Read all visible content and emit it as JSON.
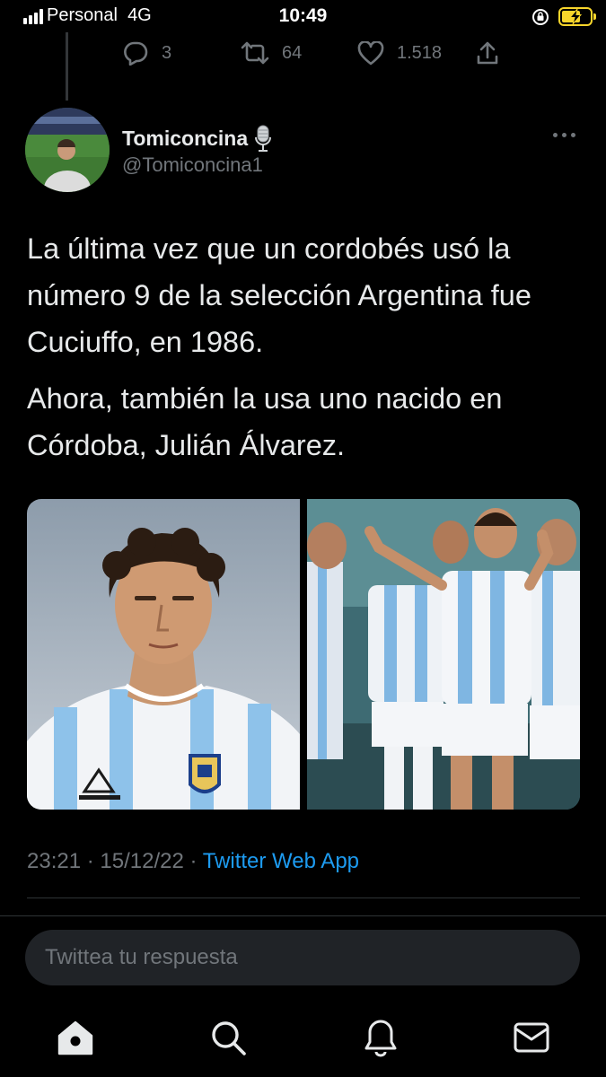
{
  "status_bar": {
    "carrier": "Personal",
    "network": "4G",
    "time": "10:49",
    "battery_color": "#f7d52b"
  },
  "previous_tweet_actions": {
    "replies": "3",
    "retweets": "64",
    "likes": "1.518"
  },
  "tweet": {
    "author_name": "Tomiconcina",
    "author_handle": "@Tomiconcina1",
    "name_badge_icon": "microphone-icon",
    "paragraph_1": "La última vez que un cordobés usó la número 9 de la selección Argentina fue Cuciuffo, en 1986.",
    "paragraph_2": "Ahora, también la usa uno nacido en Córdoba, Julián Álvarez.",
    "timestamp": "23:21 · 15/12/22 · ",
    "source": "Twitter Web App"
  },
  "reply": {
    "placeholder": "Twittea tu respuesta"
  },
  "tab_bar": {
    "icons": [
      "home-icon",
      "search-icon",
      "notifications-icon",
      "messages-icon"
    ]
  },
  "colors": {
    "background": "#000000",
    "text": "#e7e9ea",
    "muted": "#71767b",
    "accent": "#1d9bf0"
  }
}
